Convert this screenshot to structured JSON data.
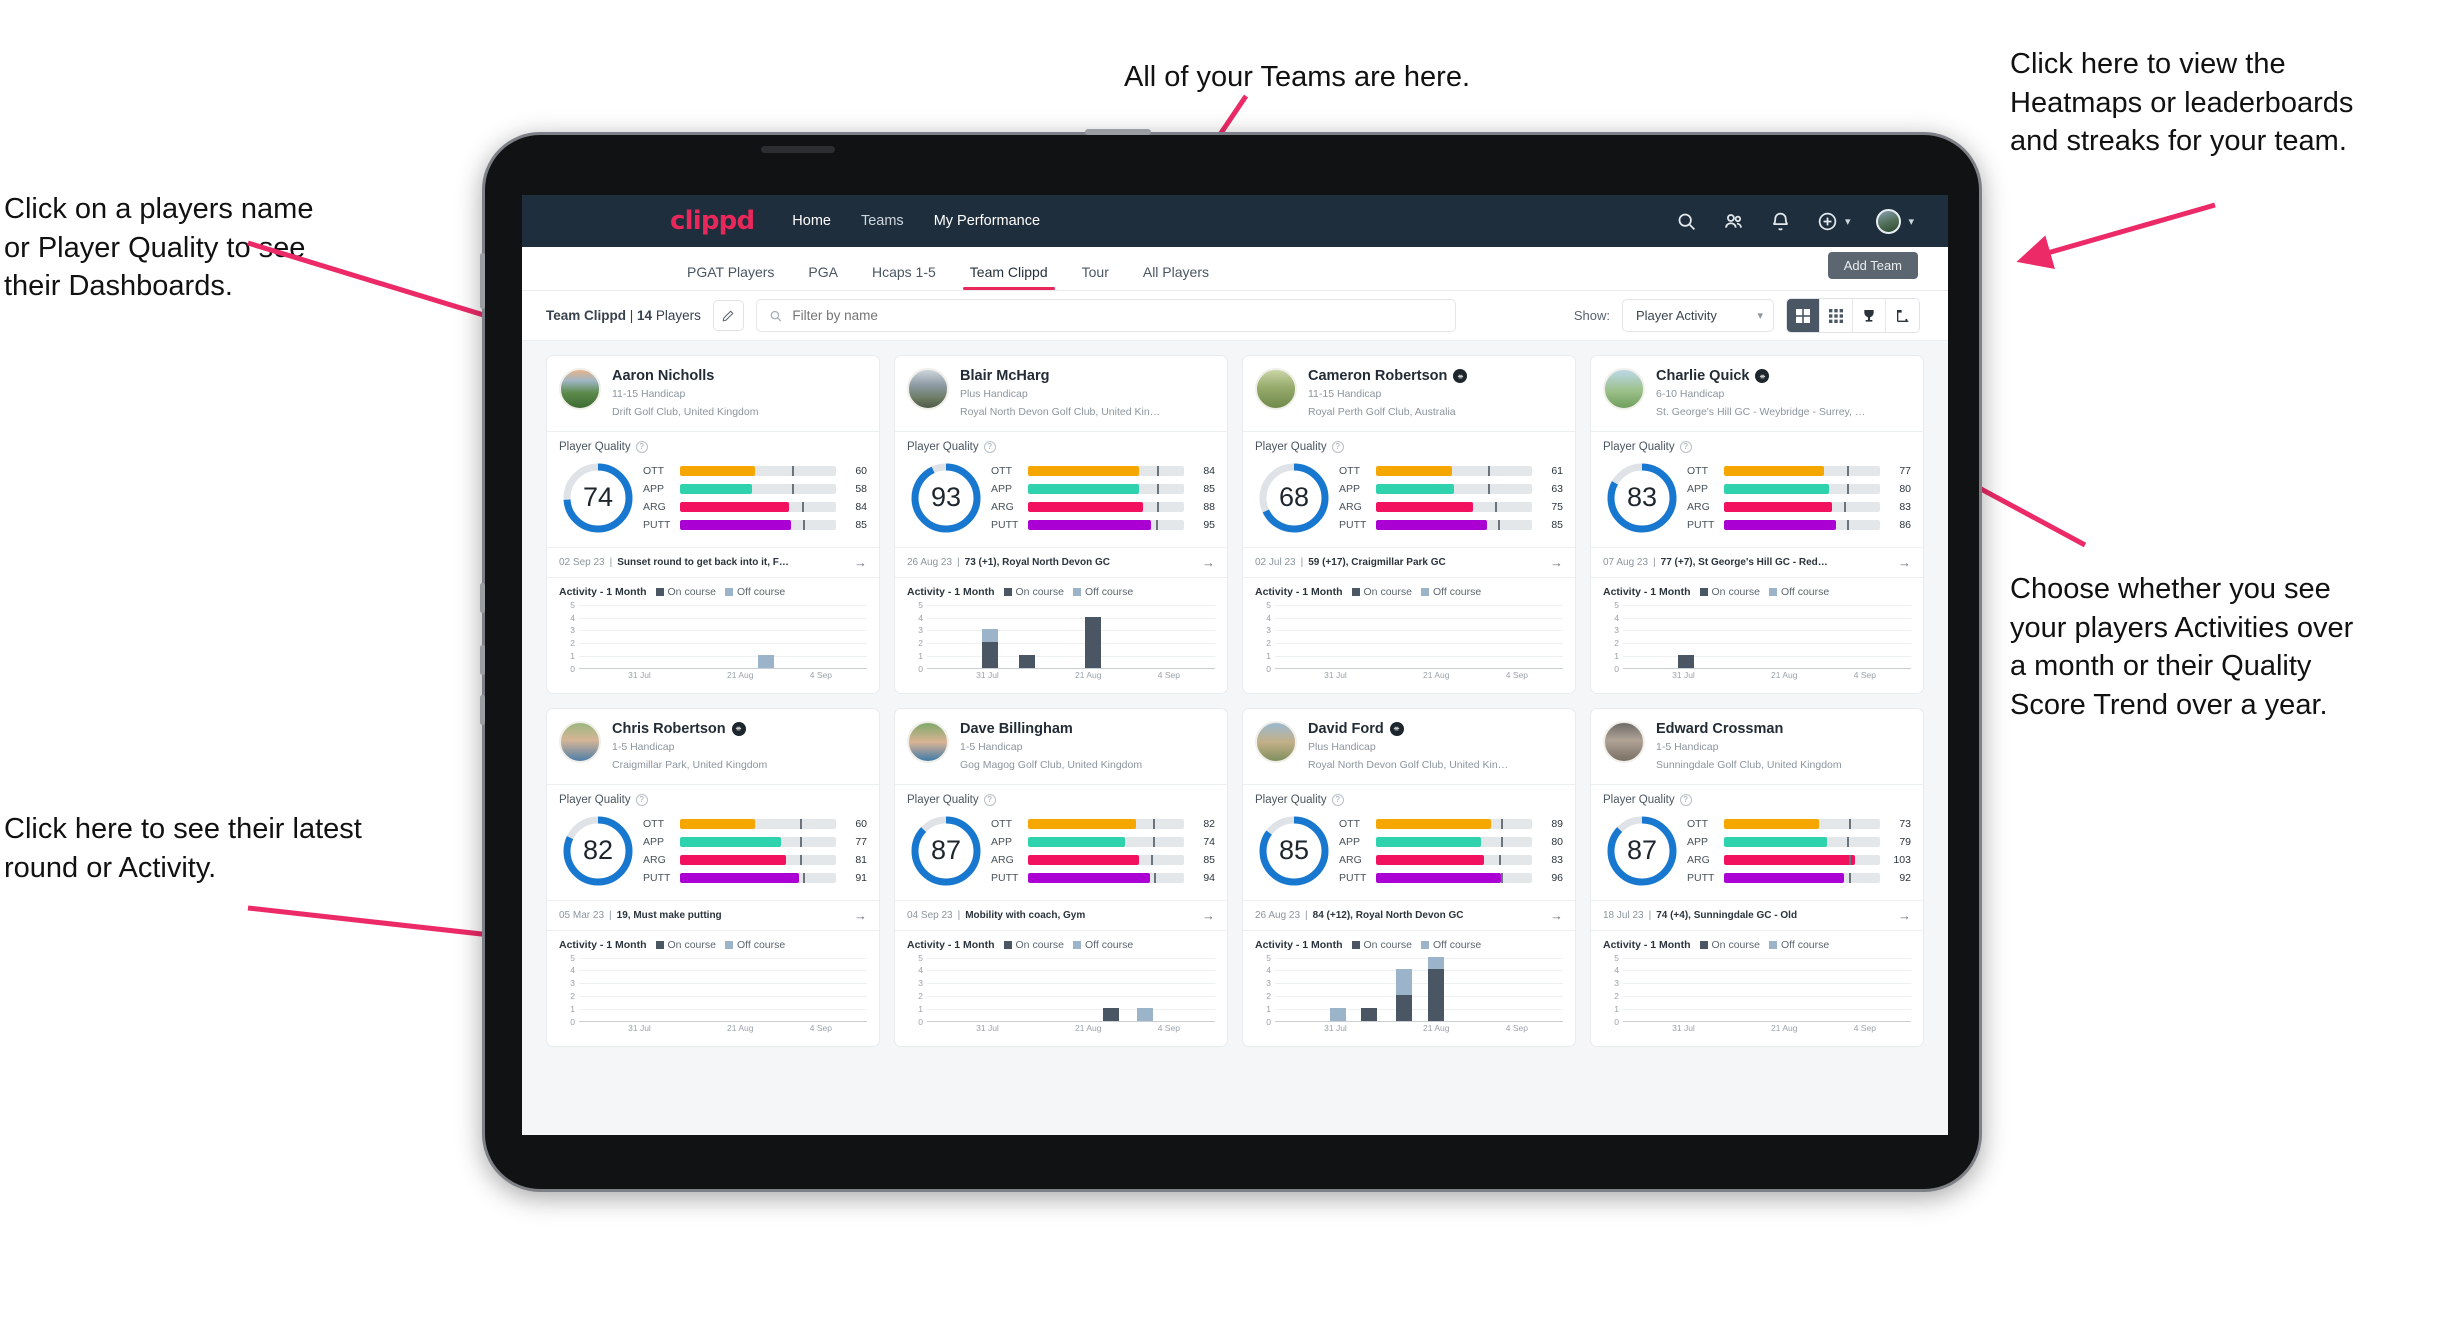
{
  "annotations": [
    {
      "id": "a-teams",
      "text": "All of your Teams are here."
    },
    {
      "id": "a-heatmaps",
      "text": "Click here to view the\nHeatmaps or leaderboards\nand streaks for your team."
    },
    {
      "id": "a-names",
      "text": "Click on a players name\nor Player Quality to see\ntheir Dashboards."
    },
    {
      "id": "a-show",
      "text": "Choose whether you see\nyour players Activities over\na month or their Quality\nScore Trend over a year."
    },
    {
      "id": "a-latest",
      "text": "Click here to see their latest\nround or Activity."
    }
  ],
  "appbar": {
    "brand": "clippd",
    "nav": [
      {
        "label": "Home",
        "active": true
      },
      {
        "label": "Teams",
        "active": false
      },
      {
        "label": "My Performance",
        "active": true
      }
    ],
    "icons": [
      "search-icon",
      "people-icon",
      "bell-icon",
      "plus-circle-icon",
      "avatar"
    ]
  },
  "tabs": [
    {
      "label": "PGAT Players",
      "active": false
    },
    {
      "label": "PGA",
      "active": false
    },
    {
      "label": "Hcaps 1-5",
      "active": false
    },
    {
      "label": "Team Clippd",
      "active": true
    },
    {
      "label": "Tour",
      "active": false
    },
    {
      "label": "All Players",
      "active": false
    }
  ],
  "add_team_label": "Add Team",
  "toolbar": {
    "team_name": "Team Clippd",
    "separator": " | ",
    "player_count": "14",
    "players_word": " Players",
    "edit_icon": "pencil-icon",
    "search_placeholder": "Filter by name",
    "search_value": "",
    "show_label": "Show:",
    "show_value": "Player Activity",
    "views": [
      {
        "icon": "grid-large-icon",
        "active": true
      },
      {
        "icon": "grid-small-icon",
        "active": false
      },
      {
        "icon": "trophy-icon",
        "active": false
      },
      {
        "icon": "heatmap-icon",
        "active": false
      }
    ]
  },
  "card_labels": {
    "player_quality": "Player Quality",
    "help_icon": "question-icon",
    "activity_title": "Activity - 1 Month",
    "legend_on": "On course",
    "legend_off": "Off course",
    "arrow": "→"
  },
  "colors": {
    "brand": "#e8285a",
    "navbar": "#1e2e3d",
    "ring": "#1878cf",
    "ott": "#f5a700",
    "app": "#2ed3ae",
    "arg": "#f2115f",
    "putt": "#aa00d4",
    "on_course": "#4a5663",
    "off_course": "#9cb4c9"
  },
  "chart_data": {
    "type": "bar",
    "title": "Activity - 1 Month",
    "ylabel": "",
    "xlabel": "",
    "ylim": [
      0,
      5
    ],
    "yticks": [
      0,
      1,
      2,
      3,
      4,
      5
    ],
    "xticks": [
      "31 Jul",
      "21 Aug",
      "4 Sep"
    ],
    "series": [
      {
        "name": "On course",
        "color": "#4a5663"
      },
      {
        "name": "Off course",
        "color": "#9cb4c9"
      }
    ],
    "legend": "top",
    "grid": true
  },
  "players": [
    {
      "name": "Aaron Nicholls",
      "verified": false,
      "handicap": "11-15 Handicap",
      "club": "Drift Golf Club, United Kingdom",
      "quality": "74",
      "ring_pct": 74,
      "metrics": [
        {
          "label": "OTT",
          "value": "60",
          "fill_pct": 48,
          "tick_pct": 72,
          "color": "#f5a700"
        },
        {
          "label": "APP",
          "value": "58",
          "fill_pct": 46,
          "tick_pct": 72,
          "color": "#2ed3ae"
        },
        {
          "label": "ARG",
          "value": "84",
          "fill_pct": 70,
          "tick_pct": 78,
          "color": "#f2115f"
        },
        {
          "label": "PUTT",
          "value": "85",
          "fill_pct": 71,
          "tick_pct": 79,
          "color": "#aa00d4"
        }
      ],
      "latest_date": "02 Sep 23",
      "latest_text": "Sunset round to get back into it, F…",
      "activity": [
        {
          "x_pct": 62,
          "on": 0,
          "off": 1
        }
      ]
    },
    {
      "name": "Blair McHarg",
      "verified": false,
      "handicap": "Plus Handicap",
      "club": "Royal North Devon Golf Club, United Kin…",
      "quality": "93",
      "ring_pct": 93,
      "metrics": [
        {
          "label": "OTT",
          "value": "84",
          "fill_pct": 71,
          "tick_pct": 83,
          "color": "#f5a700"
        },
        {
          "label": "APP",
          "value": "85",
          "fill_pct": 71,
          "tick_pct": 83,
          "color": "#2ed3ae"
        },
        {
          "label": "ARG",
          "value": "88",
          "fill_pct": 74,
          "tick_pct": 83,
          "color": "#f2115f"
        },
        {
          "label": "PUTT",
          "value": "95",
          "fill_pct": 79,
          "tick_pct": 82,
          "color": "#aa00d4"
        }
      ],
      "latest_date": "26 Aug 23",
      "latest_text": "73 (+1), Royal North Devon GC",
      "activity": [
        {
          "x_pct": 19,
          "on": 2,
          "off": 1
        },
        {
          "x_pct": 32,
          "on": 1,
          "off": 0
        },
        {
          "x_pct": 55,
          "on": 4,
          "off": 0
        }
      ]
    },
    {
      "name": "Cameron Robertson",
      "verified": true,
      "handicap": "11-15 Handicap",
      "club": "Royal Perth Golf Club, Australia",
      "quality": "68",
      "ring_pct": 68,
      "metrics": [
        {
          "label": "OTT",
          "value": "61",
          "fill_pct": 49,
          "tick_pct": 72,
          "color": "#f5a700"
        },
        {
          "label": "APP",
          "value": "63",
          "fill_pct": 50,
          "tick_pct": 72,
          "color": "#2ed3ae"
        },
        {
          "label": "ARG",
          "value": "75",
          "fill_pct": 62,
          "tick_pct": 76,
          "color": "#f2115f"
        },
        {
          "label": "PUTT",
          "value": "85",
          "fill_pct": 71,
          "tick_pct": 78,
          "color": "#aa00d4"
        }
      ],
      "latest_date": "02 Jul 23",
      "latest_text": "59 (+17), Craigmillar Park GC",
      "activity": []
    },
    {
      "name": "Charlie Quick",
      "verified": true,
      "handicap": "6-10 Handicap",
      "club": "St. George's Hill GC - Weybridge - Surrey, …",
      "quality": "83",
      "ring_pct": 83,
      "metrics": [
        {
          "label": "OTT",
          "value": "77",
          "fill_pct": 64,
          "tick_pct": 79,
          "color": "#f5a700"
        },
        {
          "label": "APP",
          "value": "80",
          "fill_pct": 67,
          "tick_pct": 79,
          "color": "#2ed3ae"
        },
        {
          "label": "ARG",
          "value": "83",
          "fill_pct": 69,
          "tick_pct": 77,
          "color": "#f2115f"
        },
        {
          "label": "PUTT",
          "value": "86",
          "fill_pct": 72,
          "tick_pct": 79,
          "color": "#aa00d4"
        }
      ],
      "latest_date": "07 Aug 23",
      "latest_text": "77 (+7), St George's Hill GC - Red…",
      "activity": [
        {
          "x_pct": 19,
          "on": 1,
          "off": 0
        }
      ]
    },
    {
      "name": "Chris Robertson",
      "verified": true,
      "handicap": "1-5 Handicap",
      "club": "Craigmillar Park, United Kingdom",
      "quality": "82",
      "ring_pct": 82,
      "metrics": [
        {
          "label": "OTT",
          "value": "60",
          "fill_pct": 48,
          "tick_pct": 77,
          "color": "#f5a700"
        },
        {
          "label": "APP",
          "value": "77",
          "fill_pct": 65,
          "tick_pct": 77,
          "color": "#2ed3ae"
        },
        {
          "label": "ARG",
          "value": "81",
          "fill_pct": 68,
          "tick_pct": 77,
          "color": "#f2115f"
        },
        {
          "label": "PUTT",
          "value": "91",
          "fill_pct": 76,
          "tick_pct": 79,
          "color": "#aa00d4"
        }
      ],
      "latest_date": "05 Mar 23",
      "latest_text": "19, Must make putting",
      "activity": []
    },
    {
      "name": "Dave Billingham",
      "verified": false,
      "handicap": "1-5 Handicap",
      "club": "Gog Magog Golf Club, United Kingdom",
      "quality": "87",
      "ring_pct": 87,
      "metrics": [
        {
          "label": "OTT",
          "value": "82",
          "fill_pct": 69,
          "tick_pct": 80,
          "color": "#f5a700"
        },
        {
          "label": "APP",
          "value": "74",
          "fill_pct": 62,
          "tick_pct": 80,
          "color": "#2ed3ae"
        },
        {
          "label": "ARG",
          "value": "85",
          "fill_pct": 71,
          "tick_pct": 79,
          "color": "#f2115f"
        },
        {
          "label": "PUTT",
          "value": "94",
          "fill_pct": 78,
          "tick_pct": 81,
          "color": "#aa00d4"
        }
      ],
      "latest_date": "04 Sep 23",
      "latest_text": "Mobility with coach, Gym",
      "activity": [
        {
          "x_pct": 61,
          "on": 1,
          "off": 0
        },
        {
          "x_pct": 73,
          "on": 0,
          "off": 1
        }
      ]
    },
    {
      "name": "David Ford",
      "verified": true,
      "handicap": "Plus Handicap",
      "club": "Royal North Devon Golf Club, United Kin…",
      "quality": "85",
      "ring_pct": 85,
      "metrics": [
        {
          "label": "OTT",
          "value": "89",
          "fill_pct": 74,
          "tick_pct": 80,
          "color": "#f5a700"
        },
        {
          "label": "APP",
          "value": "80",
          "fill_pct": 67,
          "tick_pct": 80,
          "color": "#2ed3ae"
        },
        {
          "label": "ARG",
          "value": "83",
          "fill_pct": 69,
          "tick_pct": 79,
          "color": "#f2115f"
        },
        {
          "label": "PUTT",
          "value": "96",
          "fill_pct": 80,
          "tick_pct": 80,
          "color": "#aa00d4"
        }
      ],
      "latest_date": "26 Aug 23",
      "latest_text": "84 (+12), Royal North Devon GC",
      "activity": [
        {
          "x_pct": 19,
          "on": 0,
          "off": 1
        },
        {
          "x_pct": 30,
          "on": 1,
          "off": 0
        },
        {
          "x_pct": 42,
          "on": 2,
          "off": 2
        },
        {
          "x_pct": 53,
          "on": 4,
          "off": 1
        }
      ]
    },
    {
      "name": "Edward Crossman",
      "verified": false,
      "handicap": "1-5 Handicap",
      "club": "Sunningdale Golf Club, United Kingdom",
      "quality": "87",
      "ring_pct": 87,
      "metrics": [
        {
          "label": "OTT",
          "value": "73",
          "fill_pct": 61,
          "tick_pct": 80,
          "color": "#f5a700"
        },
        {
          "label": "APP",
          "value": "79",
          "fill_pct": 66,
          "tick_pct": 79,
          "color": "#2ed3ae"
        },
        {
          "label": "ARG",
          "value": "103",
          "fill_pct": 84,
          "tick_pct": 80,
          "color": "#f2115f"
        },
        {
          "label": "PUTT",
          "value": "92",
          "fill_pct": 77,
          "tick_pct": 80,
          "color": "#aa00d4"
        }
      ],
      "latest_date": "18 Jul 23",
      "latest_text": "74 (+4), Sunningdale GC - Old",
      "activity": []
    }
  ]
}
